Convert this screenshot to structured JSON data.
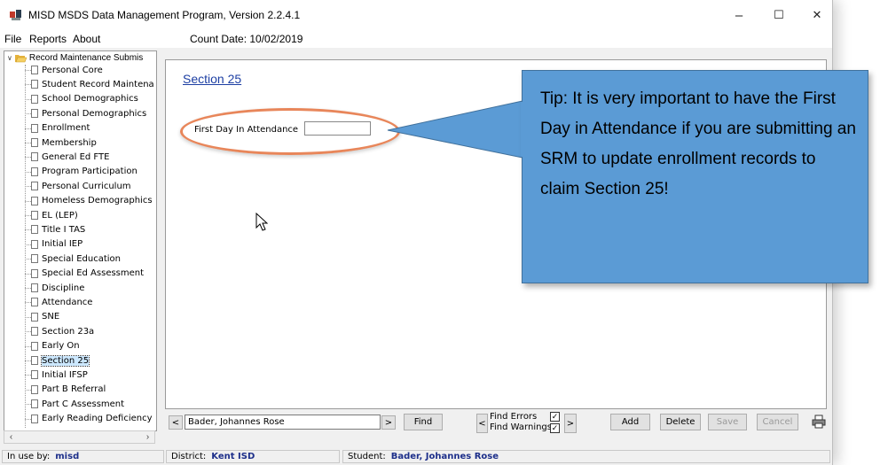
{
  "window": {
    "title": "MISD MSDS Data Management Program,  Version 2.2.4.1",
    "controls": {
      "minimize": "–",
      "maximize": "☐",
      "close": "✕"
    }
  },
  "menubar": {
    "items": [
      "File",
      "Reports",
      "About"
    ],
    "count_date": "Count Date: 10/02/2019"
  },
  "tree": {
    "root_label": "Record Maintenance Submis",
    "items": [
      {
        "label": "Personal Core"
      },
      {
        "label": "Student Record Maintena"
      },
      {
        "label": "School Demographics"
      },
      {
        "label": "Personal Demographics"
      },
      {
        "label": "Enrollment"
      },
      {
        "label": "Membership"
      },
      {
        "label": "General Ed FTE"
      },
      {
        "label": "Program Participation"
      },
      {
        "label": "Personal Curriculum"
      },
      {
        "label": "Homeless Demographics"
      },
      {
        "label": "EL (LEP)"
      },
      {
        "label": "Title I TAS"
      },
      {
        "label": "Initial IEP"
      },
      {
        "label": "Special Education"
      },
      {
        "label": "Special Ed Assessment"
      },
      {
        "label": "Discipline"
      },
      {
        "label": "Attendance"
      },
      {
        "label": "SNE"
      },
      {
        "label": "Section 23a"
      },
      {
        "label": "Early On"
      },
      {
        "label": "Section 25",
        "selected": true
      },
      {
        "label": "Initial IFSP"
      },
      {
        "label": "Part B Referral"
      },
      {
        "label": "Part C Assessment"
      },
      {
        "label": "Early Reading Deficiency"
      }
    ]
  },
  "content": {
    "section_title": "Section 25",
    "first_day_label": "First Day In Attendance",
    "first_day_value": ""
  },
  "tip": {
    "text": "Tip:  It is very important to have the First Day in Attendance if you are submitting an SRM to update enrollment records to claim Section 25!",
    "color": "#5b9bd5"
  },
  "bottombar": {
    "prev_symbol": "<",
    "next_symbol": ">",
    "student_value": "Bader, Johannes Rose",
    "find_label": "Find",
    "find_errors_label": "Find Errors",
    "find_warnings_label": "Find Warnings",
    "find_errors_checked": true,
    "find_warnings_checked": true,
    "add_label": "Add",
    "delete_label": "Delete",
    "save_label": "Save",
    "cancel_label": "Cancel",
    "print_icon": "printer-icon"
  },
  "statusbar": {
    "in_use_label": "In use by:",
    "in_use_value": "misd",
    "district_label": "District:",
    "district_value": "Kent ISD",
    "student_label": "Student:",
    "student_value": "Bader, Johannes Rose"
  }
}
